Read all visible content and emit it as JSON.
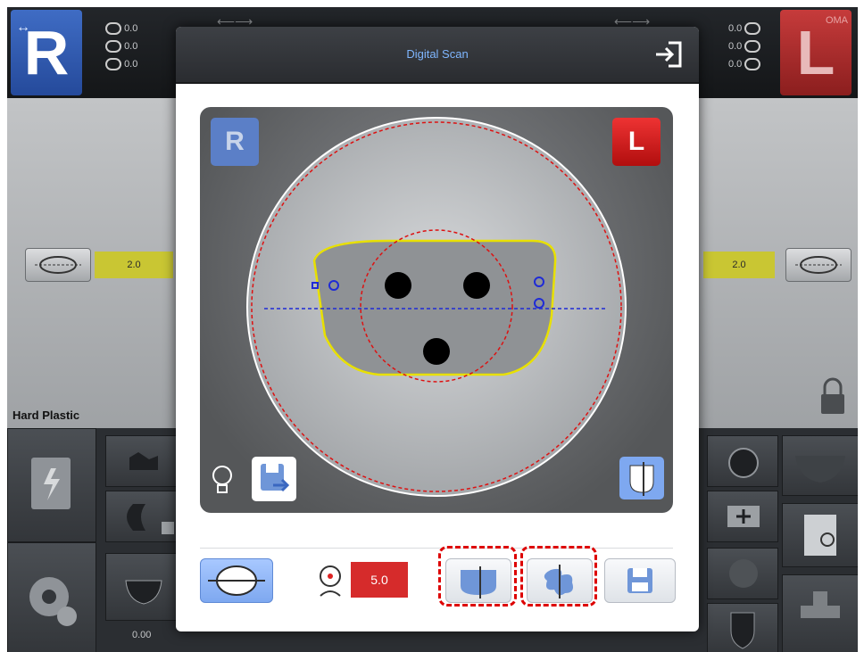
{
  "window": {
    "title": "Digital Scan"
  },
  "right_eye": {
    "label": "R",
    "axes": [
      {
        "icon": "tilt-icon",
        "value": "0.0"
      },
      {
        "icon": "rotate-icon",
        "value": "0.0"
      },
      {
        "icon": "lens-icon",
        "value": "0.0"
      }
    ]
  },
  "left_eye": {
    "label": "L",
    "tag": "OMA",
    "axes": [
      {
        "icon": "tilt-icon",
        "value": "0.0"
      },
      {
        "icon": "rotate-icon",
        "value": "0.0"
      },
      {
        "icon": "lens-icon",
        "value": "0.0"
      }
    ]
  },
  "left_panel": {
    "bevel_value": "2.0",
    "material": "Hard Plastic",
    "bottom_value": "0.00"
  },
  "right_panel": {
    "bevel_value": "2.0"
  },
  "scan": {
    "r_button": "R",
    "l_button": "L"
  },
  "toolbar": {
    "offset_value": "5.0"
  },
  "colors": {
    "accent_blue": "#3f6cc4",
    "right_red": "#d62b2b",
    "trace_yellow": "#e8e000",
    "highlight_dash": "#dd0000"
  }
}
